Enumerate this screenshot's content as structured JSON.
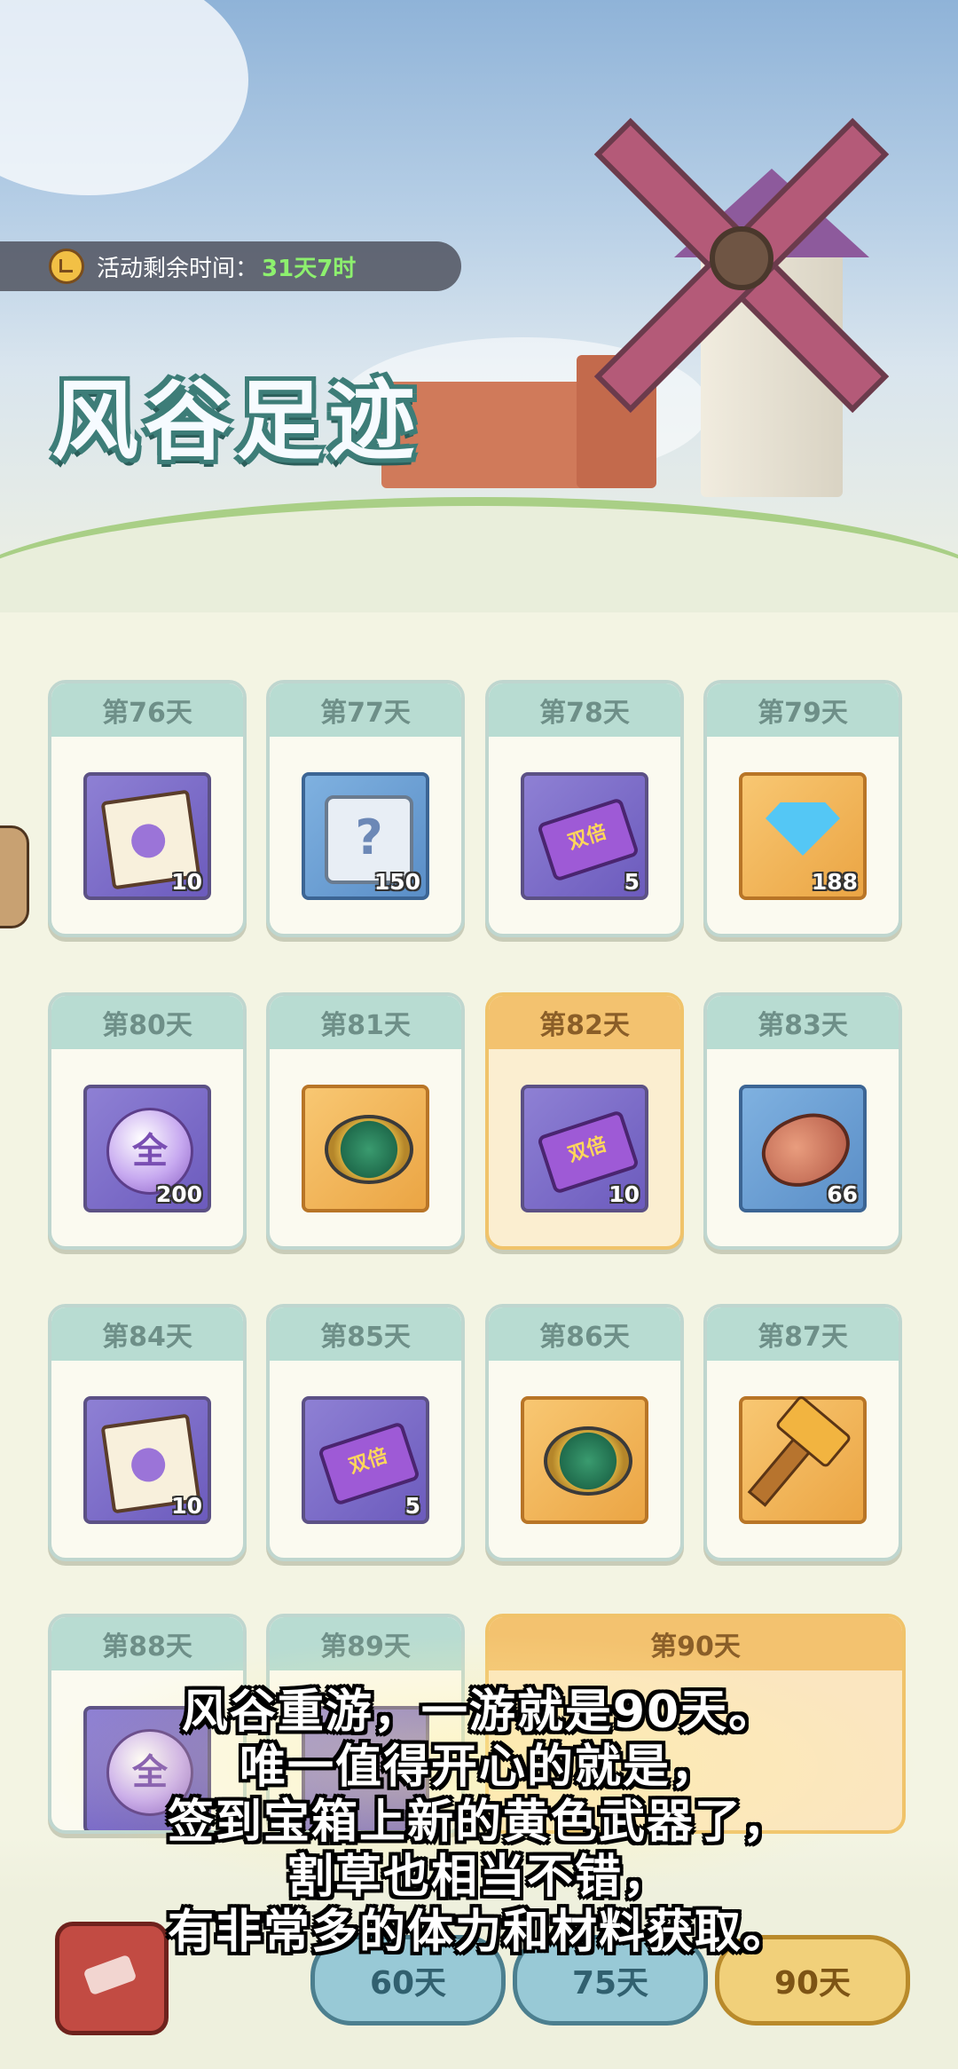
{
  "event": {
    "timer_label": "活动剩余时间：",
    "timer_value": "31天7时",
    "title": "风谷足迹"
  },
  "days": [
    {
      "label": "第76天",
      "qty": "10",
      "item": "voucher-notebook",
      "slot": "purple",
      "highlight": false
    },
    {
      "label": "第77天",
      "qty": "150",
      "item": "mystery-scroll",
      "slot": "blue",
      "highlight": false
    },
    {
      "label": "第78天",
      "qty": "5",
      "item": "double-ticket",
      "slot": "purple",
      "highlight": false
    },
    {
      "label": "第79天",
      "qty": "188",
      "item": "diamond",
      "slot": "orange",
      "highlight": false
    },
    {
      "label": "第80天",
      "qty": "200",
      "item": "all-orb",
      "slot": "purple",
      "highlight": false
    },
    {
      "label": "第81天",
      "qty": "",
      "item": "spinning-top",
      "slot": "orange",
      "highlight": false
    },
    {
      "label": "第82天",
      "qty": "10",
      "item": "double-ticket",
      "slot": "purple",
      "highlight": true
    },
    {
      "label": "第83天",
      "qty": "66",
      "item": "meat",
      "slot": "blue",
      "highlight": false
    },
    {
      "label": "第84天",
      "qty": "10",
      "item": "voucher-notebook",
      "slot": "purple",
      "highlight": false
    },
    {
      "label": "第85天",
      "qty": "5",
      "item": "double-ticket",
      "slot": "purple",
      "highlight": false
    },
    {
      "label": "第86天",
      "qty": "",
      "item": "spinning-top",
      "slot": "orange",
      "highlight": false
    },
    {
      "label": "第87天",
      "qty": "",
      "item": "golden-hammer",
      "slot": "orange",
      "highlight": false
    },
    {
      "label": "第88天",
      "qty": "",
      "item": "all-orb",
      "slot": "purple",
      "highlight": false
    },
    {
      "label": "第89天",
      "qty": "",
      "item": "",
      "slot": "purple",
      "highlight": false
    }
  ],
  "item_text": {
    "double_ticket": "双倍",
    "scroll": "?",
    "orb": "全"
  },
  "final_day": {
    "label": "第90天"
  },
  "tabs": [
    {
      "label": "60天"
    },
    {
      "label": "75天"
    },
    {
      "label": "90天"
    }
  ],
  "subtitle": [
    "风谷重游，一游就是90天。",
    "唯一值得开心的就是，",
    "签到宝箱上新的黄色武器了，",
    "割草也相当不错，",
    "有非常多的体力和材料获取。"
  ]
}
